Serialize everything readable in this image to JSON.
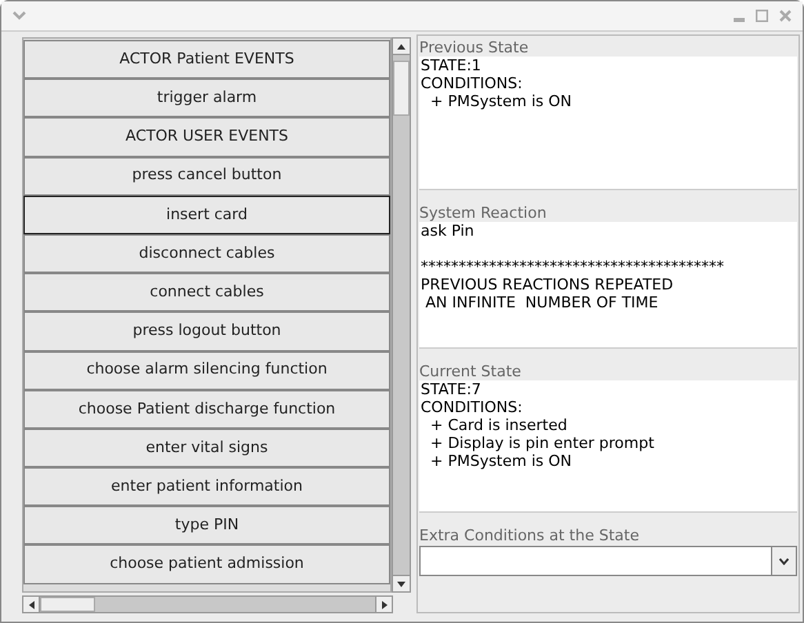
{
  "events": [
    {
      "label": "ACTOR Patient EVENTS",
      "selected": false
    },
    {
      "label": "trigger alarm",
      "selected": false
    },
    {
      "label": "ACTOR USER EVENTS",
      "selected": false
    },
    {
      "label": "press cancel button",
      "selected": false
    },
    {
      "label": "insert card",
      "selected": true
    },
    {
      "label": "disconnect cables",
      "selected": false
    },
    {
      "label": "connect cables",
      "selected": false
    },
    {
      "label": "press logout button",
      "selected": false
    },
    {
      "label": "choose alarm silencing function",
      "selected": false
    },
    {
      "label": "choose Patient discharge function",
      "selected": false
    },
    {
      "label": "enter vital signs",
      "selected": false
    },
    {
      "label": "enter patient information",
      "selected": false
    },
    {
      "label": "type PIN",
      "selected": false
    },
    {
      "label": "choose patient admission",
      "selected": false
    }
  ],
  "previous_state": {
    "title": "Previous State",
    "lines": [
      "STATE:1",
      "CONDITIONS:",
      "  + PMSystem is ON"
    ]
  },
  "system_reaction": {
    "title": "System Reaction",
    "lines": [
      "ask Pin"
    ],
    "separator": "****************************************",
    "after_lines": [
      "PREVIOUS REACTIONS REPEATED",
      " AN INFINITE  NUMBER OF TIME"
    ]
  },
  "current_state": {
    "title": "Current State",
    "lines": [
      "STATE:7",
      "CONDITIONS:",
      "  + Card is inserted",
      "  + Display is pin enter prompt",
      "  + PMSystem is ON"
    ]
  },
  "extra_conditions": {
    "title": "Extra Conditions at the State"
  }
}
